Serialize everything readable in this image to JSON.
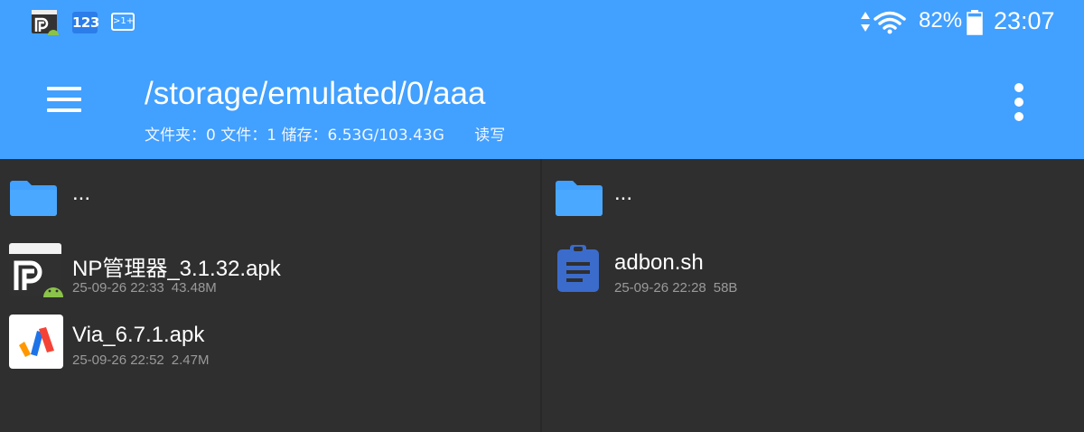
{
  "status_bar": {
    "app_icons": [
      "np-manager-icon",
      "keyboard-123-icon",
      "more-notifications-icon"
    ],
    "keyboard_label": "123",
    "more_label": ">1+",
    "battery_percent": "82%",
    "battery_level": 0.82,
    "time": "23:07"
  },
  "toolbar": {
    "path": "/storage/emulated/0/aaa",
    "stats": {
      "folders": "文件夹：0",
      "files": "文件：1",
      "storage": "储存：6.53G/103.43G",
      "mode": "读写"
    }
  },
  "left_pane": {
    "parent": {
      "label": "..."
    },
    "files": [
      {
        "name": "NP管理器_3.1.32.apk",
        "date": "25-09-26 22:33",
        "size": "43.48M",
        "icon": "np-manager-apk-icon"
      },
      {
        "name": "Via_6.7.1.apk",
        "date": "25-09-26 22:52",
        "size": "2.47M",
        "icon": "via-browser-apk-icon"
      }
    ]
  },
  "right_pane": {
    "parent": {
      "label": "..."
    },
    "files": [
      {
        "name": "adbon.sh",
        "date": "25-09-26 22:28",
        "size": "58B",
        "icon": "script-file-icon"
      }
    ]
  },
  "colors": {
    "appbar": "#42a0ff",
    "background": "#2f2f2f",
    "folder": "#42a0ff",
    "script_icon": "#3b6ccc"
  }
}
